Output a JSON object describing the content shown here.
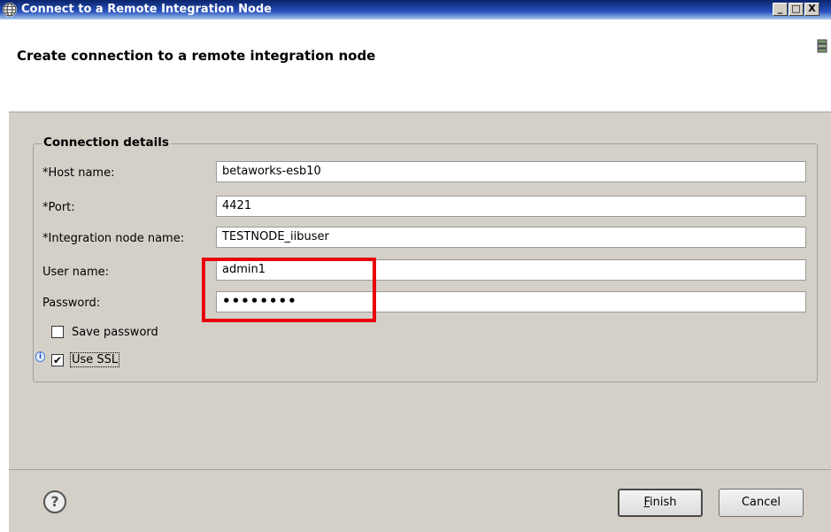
{
  "window": {
    "title": "Connect to a Remote Integration Node",
    "minimize": "_",
    "maximize": "□",
    "close": "X"
  },
  "header": {
    "heading": "Create connection to a remote integration node"
  },
  "connection": {
    "legend": "Connection details",
    "host_label": "*Host name:",
    "host_value": "betaworks-esb10",
    "port_label": "*Port:",
    "port_value": "4421",
    "node_label": "*Integration node name:",
    "node_value": "TESTNODE_iibuser",
    "user_label": "User name:",
    "user_value": "admin1",
    "password_label": "Password:",
    "password_value": "••••••••",
    "save_password_label": "Save password",
    "save_password_checked": false,
    "use_ssl_label": "Use SSL",
    "use_ssl_checked": true
  },
  "footer": {
    "help": "?",
    "finish_first": "F",
    "finish_rest": "inish",
    "cancel": "Cancel"
  },
  "colors": {
    "highlight": "#e8000b",
    "titlebar": "#0a246a"
  }
}
